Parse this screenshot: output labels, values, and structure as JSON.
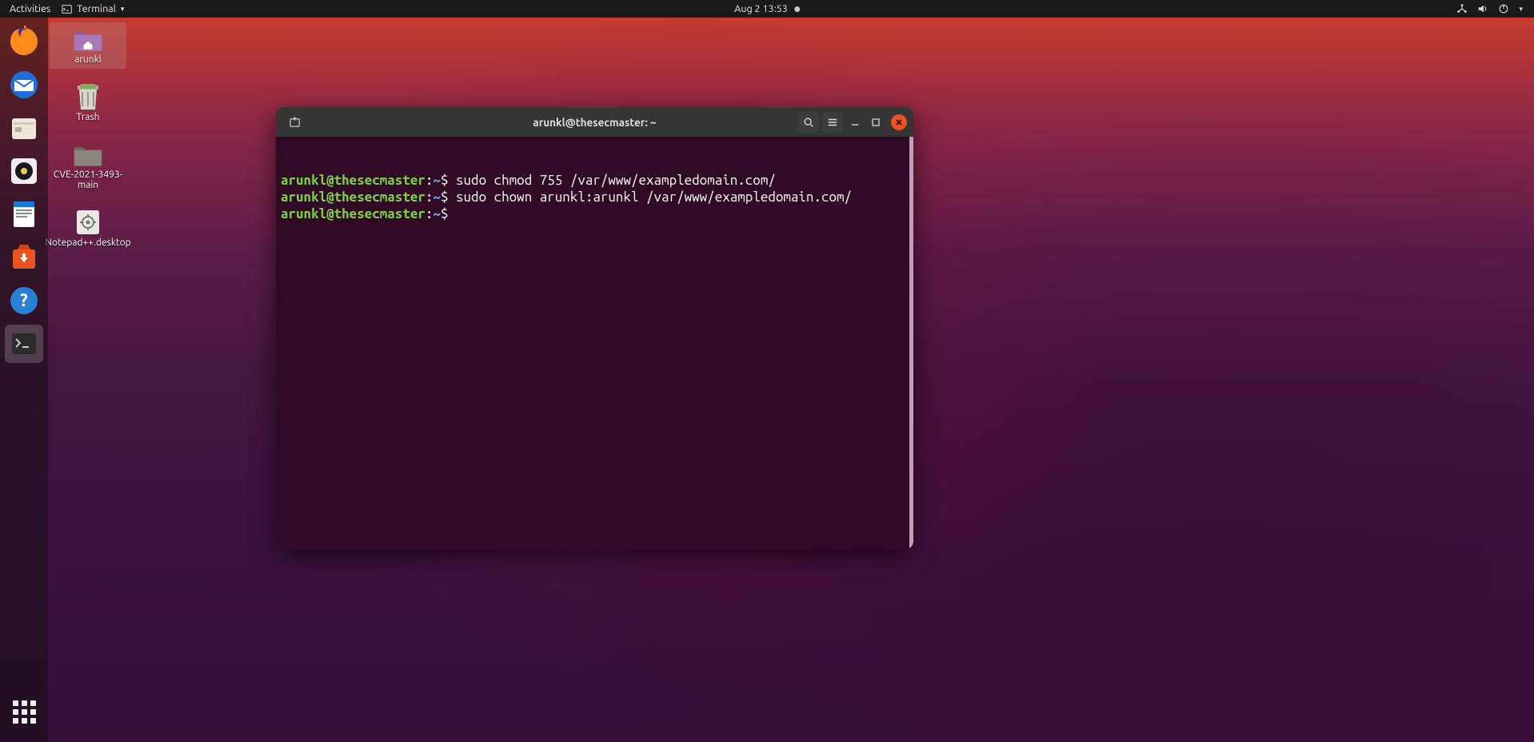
{
  "topbar": {
    "activities": "Activities",
    "app_label": "Terminal",
    "datetime": "Aug 2  13:53"
  },
  "desktop_icons": [
    {
      "label": "arunkl"
    },
    {
      "label": "Trash"
    },
    {
      "label": "CVE-2021-3493-main"
    },
    {
      "label": "Notepad++.desktop"
    }
  ],
  "terminal": {
    "title": "arunkl@thesecmaster: ~",
    "prompt_user": "arunkl@thesecmaster",
    "prompt_path": "~",
    "lines": [
      {
        "command": "sudo chmod 755 /var/www/exampledomain.com/"
      },
      {
        "command": "sudo chown arunkl:arunkl /var/www/exampledomain.com/"
      },
      {
        "command": ""
      }
    ]
  }
}
